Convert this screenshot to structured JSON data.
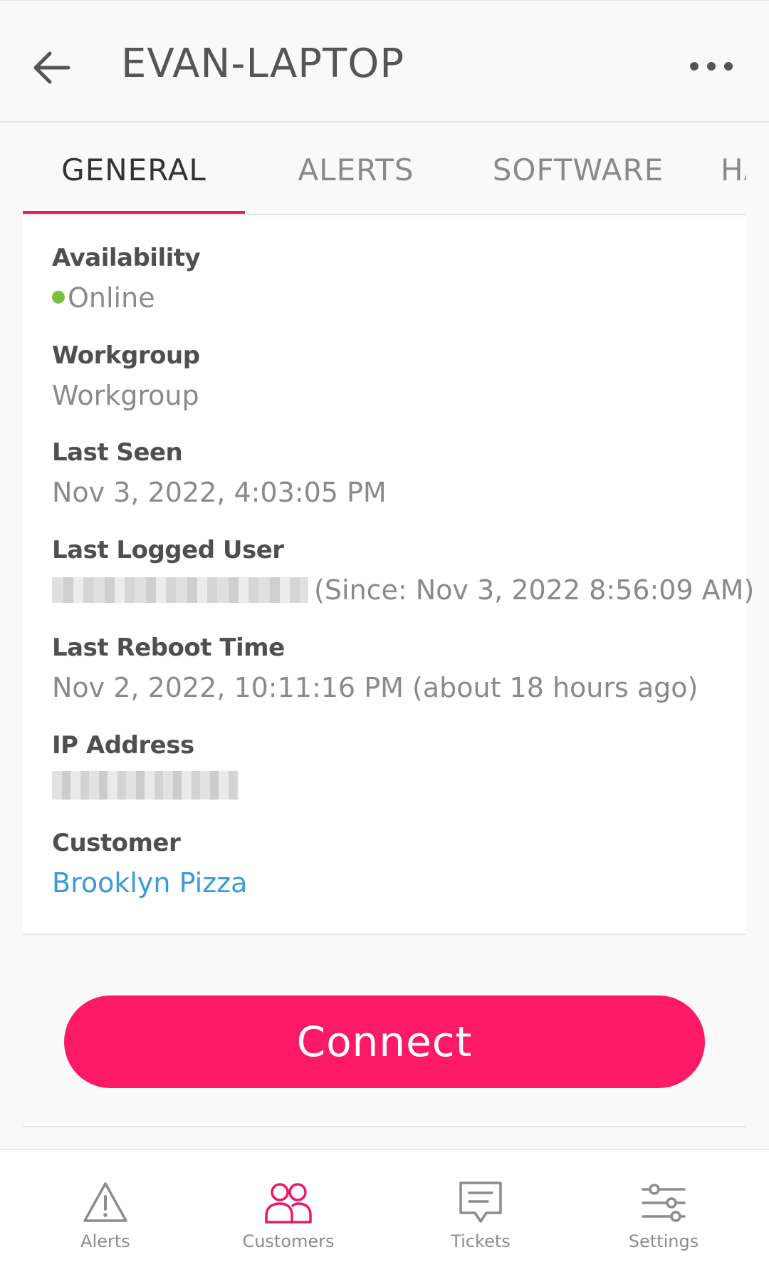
{
  "header": {
    "title": "EVAN-LAPTOP",
    "back_icon": "arrow-left-icon",
    "more_icon": "more-horizontal-icon"
  },
  "tabs": [
    {
      "label": "GENERAL",
      "active": true
    },
    {
      "label": "ALERTS",
      "active": false
    },
    {
      "label": "SOFTWARE",
      "active": false
    },
    {
      "label": "HA",
      "active": false
    }
  ],
  "details": {
    "availability": {
      "label": "Availability",
      "value": "Online",
      "status_color": "#7bc043"
    },
    "workgroup": {
      "label": "Workgroup",
      "value": "Workgroup"
    },
    "last_seen": {
      "label": "Last Seen",
      "value": "Nov 3, 2022, 4:03:05 PM"
    },
    "last_logged_user": {
      "label": "Last Logged User",
      "value": "(Since: Nov 3, 2022 8:56:09 AM)"
    },
    "last_reboot": {
      "label": "Last Reboot Time",
      "value": "Nov 2, 2022, 10:11:16 PM (about 18 hours ago)"
    },
    "ip_address": {
      "label": "IP Address"
    },
    "customer": {
      "label": "Customer",
      "value": "Brooklyn Pizza"
    }
  },
  "connect_button": {
    "label": "Connect",
    "color": "#fc1966"
  },
  "bottom_nav": [
    {
      "label": "Alerts",
      "icon": "alert-triangle-icon",
      "active": false
    },
    {
      "label": "Customers",
      "icon": "users-icon",
      "active": true
    },
    {
      "label": "Tickets",
      "icon": "message-square-icon",
      "active": false
    },
    {
      "label": "Settings",
      "icon": "sliders-icon",
      "active": false
    }
  ],
  "colors": {
    "accent": "#ed1968",
    "link": "#3a9bd9"
  }
}
